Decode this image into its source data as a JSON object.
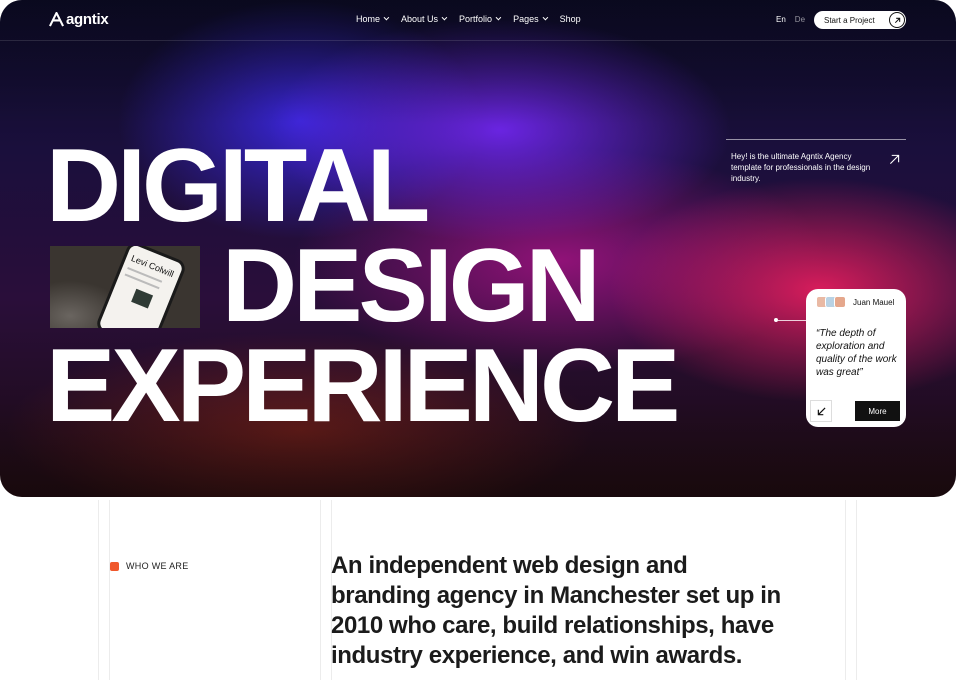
{
  "nav": {
    "brand": "agntix",
    "menu": [
      {
        "label": "Home",
        "has_dropdown": true
      },
      {
        "label": "About Us",
        "has_dropdown": true
      },
      {
        "label": "Portfolio",
        "has_dropdown": true
      },
      {
        "label": "Pages",
        "has_dropdown": true
      },
      {
        "label": "Shop",
        "has_dropdown": false
      }
    ],
    "languages": [
      "En",
      "De"
    ],
    "cta_label": "Start a Project"
  },
  "hero": {
    "line1": "DIGITAL",
    "line2": "DESIGN",
    "line3": "EXPERIENCE",
    "thumbnail_phone_text": "Levi Colwill",
    "tagline": "Hey! is the ultimate Agntix Agency template for professionals in the design industry."
  },
  "testimonial": {
    "name": "Juan Mauel",
    "quote": "“The depth of exploration and quality of the work was great”",
    "more_label": "More"
  },
  "about": {
    "label": "WHO WE ARE",
    "text": "An independent web design and branding agency in Manchester set up in 2010 who care, build relationships, have industry experience, and win awards."
  },
  "colors": {
    "accent": "#f0582c",
    "dark": "#111111",
    "hero_blue": "#3c28e6",
    "hero_pink": "#eb1e5f"
  },
  "icons": [
    "logo-icon",
    "chevron-down-icon",
    "arrow-up-right-icon",
    "arrow-down-left-icon"
  ]
}
